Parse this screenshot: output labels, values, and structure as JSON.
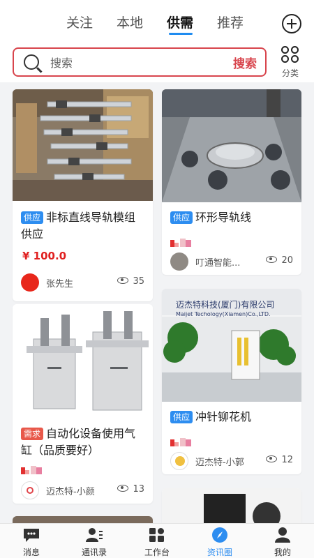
{
  "header": {
    "tabs": [
      {
        "label": "关注"
      },
      {
        "label": "本地"
      },
      {
        "label": "供需"
      },
      {
        "label": "推荐"
      }
    ],
    "active_tab": "供需",
    "add_icon": "plus-circle-icon"
  },
  "search": {
    "placeholder": "搜索",
    "button_label": "搜索",
    "accent_color": "#d8454d",
    "category_label": "分类"
  },
  "feed": {
    "left": [
      {
        "tag": "供应",
        "title": "非标直线导轨模组供应",
        "price": "¥ 100.0",
        "author": "张先生",
        "views": "35"
      },
      {
        "tag": "需求",
        "title": "自动化设备使用气缸（品质要好）",
        "author": "迈杰特-小颜",
        "views": "13"
      }
    ],
    "right": [
      {
        "tag": "供应",
        "title": "环形导轨线",
        "author": "叮通智能...",
        "views": "20"
      },
      {
        "sign_line1": "迈杰特科技(厦门)有限公司",
        "sign_line2": "Maijet Techology(Xiamen)Co.,LTD.",
        "tag": "供应",
        "title": "冲针铆花机",
        "author": "迈杰特-小郭",
        "views": "12"
      }
    ]
  },
  "bottom_nav": [
    {
      "label": "消息",
      "icon": "chat-icon"
    },
    {
      "label": "通讯录",
      "icon": "contacts-icon"
    },
    {
      "label": "工作台",
      "icon": "workbench-icon"
    },
    {
      "label": "资讯圈",
      "icon": "compass-icon"
    },
    {
      "label": "我的",
      "icon": "profile-icon"
    }
  ],
  "active_nav": "资讯圈",
  "colors": {
    "supply_tag": "#2d8df0",
    "demand_tag": "#e8584a",
    "price": "#e02020",
    "active_nav": "#2d8df0"
  }
}
